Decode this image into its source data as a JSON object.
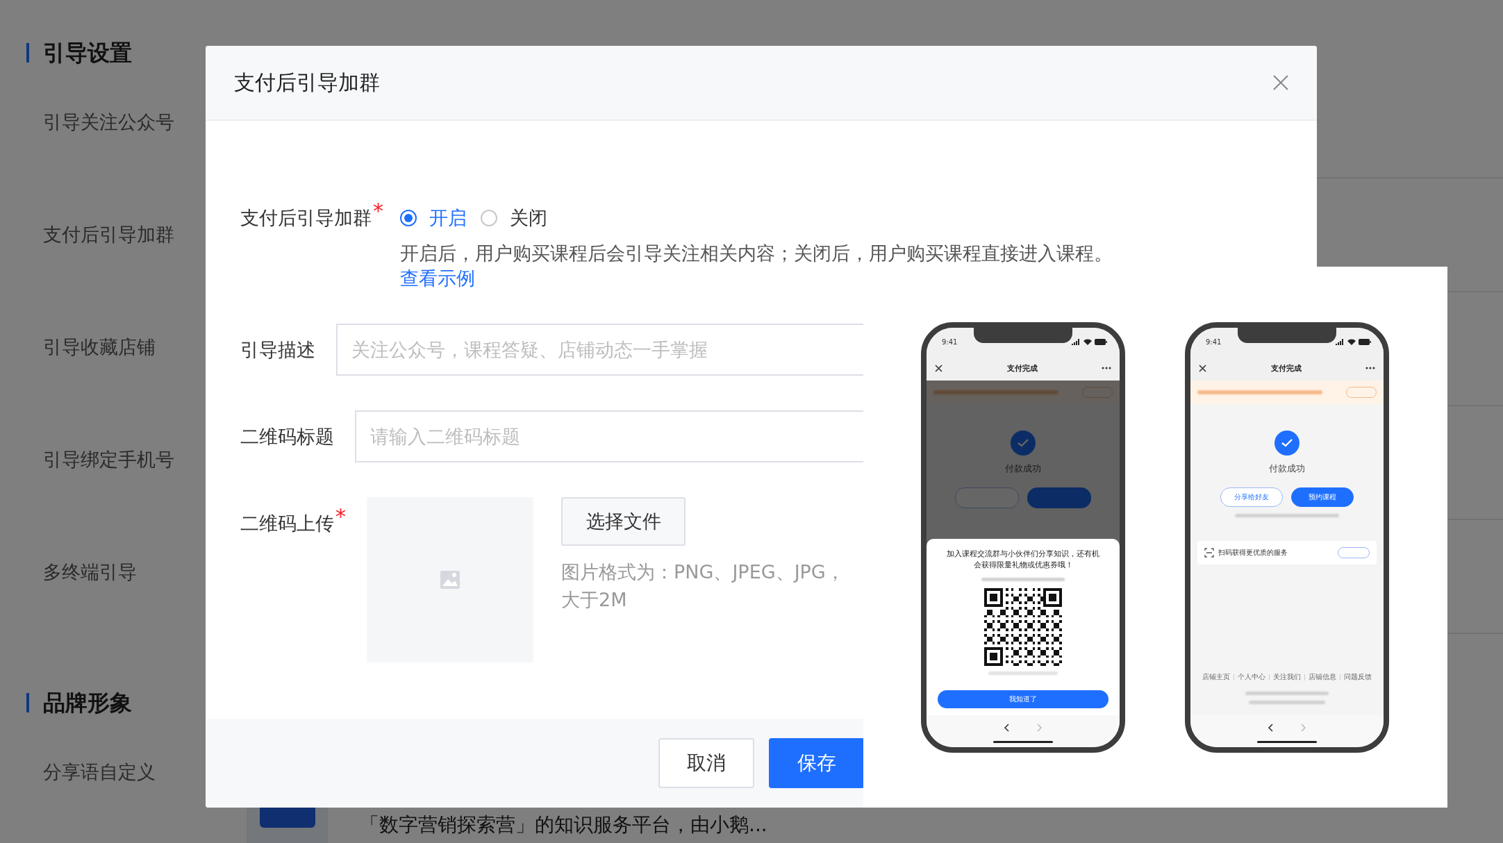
{
  "sidebar": {
    "sections": [
      {
        "title": "引导设置",
        "items": [
          {
            "label": "引导关注公众号"
          },
          {
            "label": "支付后引导加群"
          },
          {
            "label": "引导收藏店铺"
          },
          {
            "label": "引导绑定手机号"
          },
          {
            "label": "多终端引导"
          }
        ]
      },
      {
        "title": "品牌形象",
        "items": [
          {
            "label": "分享语自定义"
          }
        ]
      }
    ]
  },
  "background_item": {
    "description": "「数字营销探索营」的知识服务平台，由小鹅..."
  },
  "dialog": {
    "title": "支付后引导加群",
    "fields": [
      {
        "kind": "radio",
        "label": "支付后引导加群",
        "required_mark": "*",
        "options": [
          {
            "label": "开启",
            "selected": true
          },
          {
            "label": "关闭",
            "selected": false
          }
        ],
        "help": "开启后，用户购买课程后会引导关注相关内容；关闭后，用户购买课程直接进入课程。",
        "link": "查看示例"
      },
      {
        "kind": "text",
        "label": "引导描述",
        "placeholder": "关注公众号，课程答疑、店铺动态一手掌握"
      },
      {
        "kind": "text",
        "label": "二维码标题",
        "placeholder": "请输入二维码标题"
      },
      {
        "kind": "upload",
        "label": "二维码上传",
        "required_mark": "*",
        "button": "选择文件",
        "hint": [
          "图片格式为：PNG、JPEG、JPG，",
          "大于2M"
        ]
      }
    ],
    "buttons": [
      {
        "label": "取消",
        "kind": "default"
      },
      {
        "label": "保存",
        "kind": "primary"
      }
    ]
  },
  "example_popover": {
    "phones": [
      {
        "kind": "sheet",
        "time": "9:41",
        "nav_title": "支付完成",
        "status": "付款成功",
        "sheet": {
          "message": "加入课程交流群与小伙伴们分享知识，还有机会获得限量礼物或优惠券哦！",
          "button": "我知道了"
        }
      },
      {
        "kind": "page",
        "time": "9:41",
        "nav_title": "支付完成",
        "status": "付款成功",
        "actions": [
          {
            "label": "分享给好友",
            "kind": "outline"
          },
          {
            "label": "预约课程",
            "kind": "primary"
          }
        ],
        "service": "扫码获得更优质的服务",
        "footer_links": [
          "店铺主页",
          "个人中心",
          "关注我们",
          "店铺信息",
          "问题反馈"
        ]
      }
    ]
  }
}
